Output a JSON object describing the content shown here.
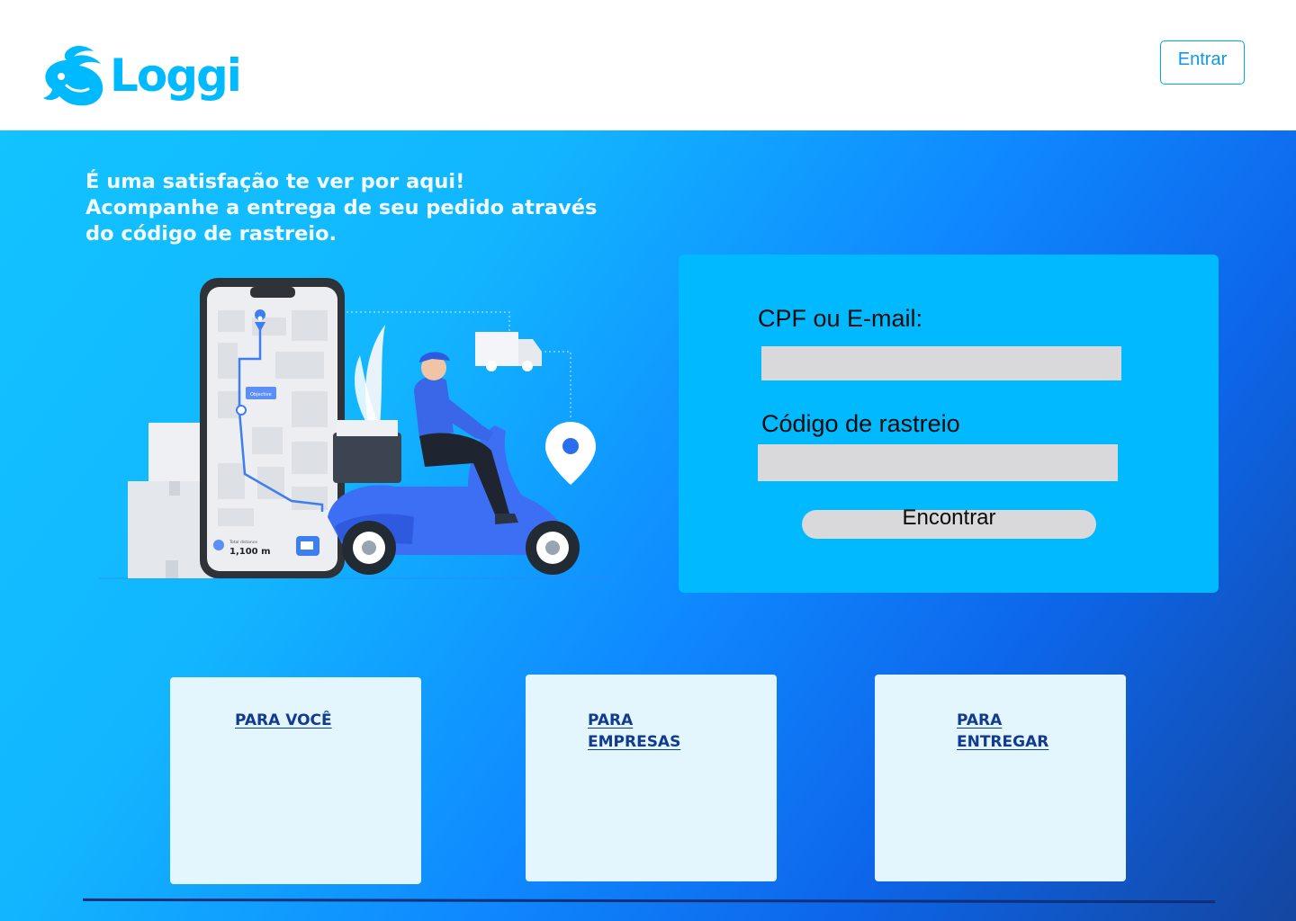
{
  "header": {
    "brand": "Loggi",
    "login_label": "Entrar"
  },
  "hero": {
    "welcome_lines": [
      "É uma satisfação te ver por aqui!",
      "Acompanhe a entrega de seu pedido através",
      "do código de rastreio."
    ],
    "illustration": {
      "map_badge": "Objective",
      "distance_label": "Total distance",
      "distance_value": "1,100 m"
    }
  },
  "form": {
    "cpf_label": "CPF ou E-mail:",
    "cpf_value": "",
    "code_label": "Código de rastreio",
    "code_value": "",
    "submit_label": "Encontrar"
  },
  "cards": [
    {
      "label": "PARA VOCÊ"
    },
    {
      "label": "PARA EMPRESAS"
    },
    {
      "label": "PARA ENTREGAR"
    }
  ],
  "colors": {
    "brand": "#00baff",
    "form_card": "#00b9ff",
    "card_bg": "#e3f6fd",
    "card_link": "#123b8f",
    "input_bg": "#d9d9db"
  },
  "icons": [
    "rabbit-logo-icon",
    "map-pin-icon",
    "delivery-truck-icon",
    "location-pin-icon"
  ]
}
